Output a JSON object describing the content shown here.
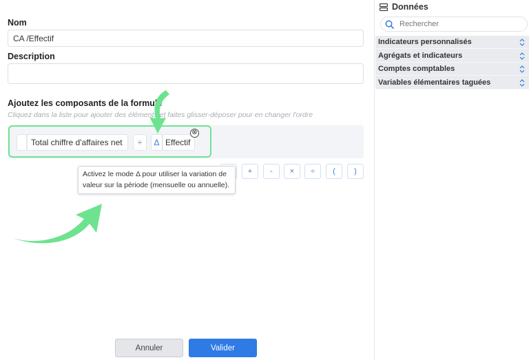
{
  "form": {
    "nom_label": "Nom",
    "nom_value": "CA /Effectif",
    "description_label": "Description",
    "description_value": "",
    "components_label": "Ajoutez les composants de la formule",
    "components_help": "Cliquez dans la liste pour ajouter des éléments et faites glisser-déposer pour en changer l'ordre",
    "formula": {
      "item1": "Total chiffre d'affaires net",
      "operator": "÷",
      "delta_symbol": "Δ",
      "item2": "Effectif",
      "remove_icon": "⊗"
    },
    "operator_buttons": [
      "+",
      "-",
      "×",
      "÷",
      "(",
      ")"
    ],
    "tooltip": "Activez le mode Δ pour utiliser la variation de valeur sur la période (mensuelle ou annuelle).",
    "cancel_label": "Annuler",
    "submit_label": "Valider"
  },
  "panel": {
    "title": "Données",
    "search_placeholder": "Rechercher",
    "sections": [
      "Indicateurs personnalisés",
      "Agrégats et indicateurs",
      "Comptes comptables",
      "Variables élémentaires taguées"
    ]
  },
  "colors": {
    "accent": "#2f7ae5",
    "highlight_green": "#6ee38f",
    "panel_section_bg": "#e9ebef"
  }
}
